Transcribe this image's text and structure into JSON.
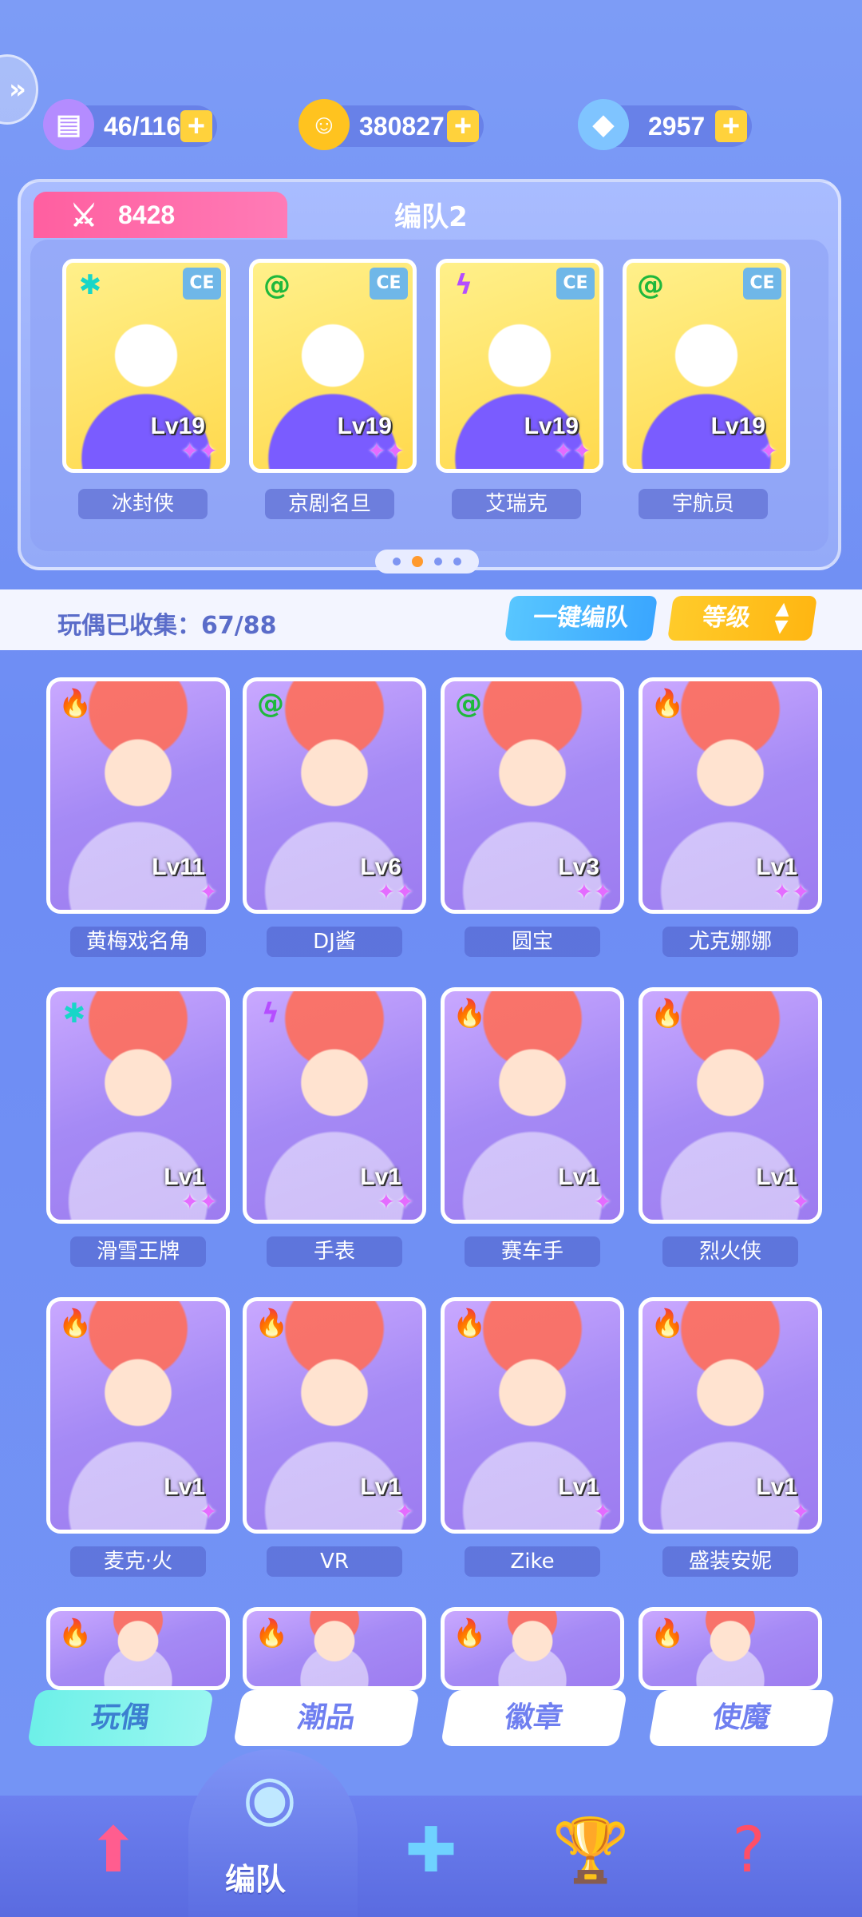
{
  "resources": [
    {
      "id": "stamina",
      "icon": "stamina-ticket-icon",
      "value": "46/116",
      "color": "#b48cff"
    },
    {
      "id": "coins",
      "icon": "coin-icon",
      "value": "380827",
      "color": "#ffc31f"
    },
    {
      "id": "gems",
      "icon": "crystal-icon",
      "value": "2957",
      "color": "#7fc4ff"
    }
  ],
  "team": {
    "power": "8428",
    "name": "编队2",
    "page_dots": 4,
    "active_page": 1,
    "members": [
      {
        "name": "冰封侠",
        "level": "Lv19",
        "element": "ice",
        "stars": "✦✦",
        "bg": "#fff08a"
      },
      {
        "name": "京剧名旦",
        "level": "Lv19",
        "element": "wind",
        "stars": "✦✦",
        "bg": "#fff08a"
      },
      {
        "name": "艾瑞克",
        "level": "Lv19",
        "element": "thunder",
        "stars": "✦✦",
        "bg": "#fff08a"
      },
      {
        "name": "宇航员",
        "level": "Lv19",
        "element": "wind",
        "stars": "✦",
        "bg": "#fff08a"
      }
    ],
    "badge": "CE"
  },
  "collection": {
    "label": "玩偶已收集：67/88",
    "onekey_label": "一键编队",
    "sort_label": "等级"
  },
  "dolls": [
    {
      "name": "黄梅戏名角",
      "level": "Lv11",
      "element": "fire",
      "stars": "✦"
    },
    {
      "name": "DJ酱",
      "level": "Lv6",
      "element": "wind",
      "stars": "✦✦"
    },
    {
      "name": "圆宝",
      "level": "Lv3",
      "element": "wind",
      "stars": "✦✦"
    },
    {
      "name": "尤克娜娜",
      "level": "Lv1",
      "element": "fire",
      "stars": "✦✦"
    },
    {
      "name": "滑雪王牌",
      "level": "Lv1",
      "element": "ice",
      "stars": "✦✦"
    },
    {
      "name": "手表",
      "level": "Lv1",
      "element": "thunder",
      "stars": "✦✦"
    },
    {
      "name": "赛车手",
      "level": "Lv1",
      "element": "fire",
      "stars": "✦"
    },
    {
      "name": "烈火侠",
      "level": "Lv1",
      "element": "fire",
      "stars": "✦"
    },
    {
      "name": "麦克·火",
      "level": "Lv1",
      "element": "fire",
      "stars": "✦"
    },
    {
      "name": "VR",
      "level": "Lv1",
      "element": "fire",
      "stars": "✦"
    },
    {
      "name": "Zike",
      "level": "Lv1",
      "element": "fire",
      "stars": "✦"
    },
    {
      "name": "盛装安妮",
      "level": "Lv1",
      "element": "fire",
      "stars": "✦"
    },
    {
      "name": "",
      "level": "",
      "element": "fire",
      "stars": ""
    },
    {
      "name": "",
      "level": "",
      "element": "fire",
      "stars": ""
    },
    {
      "name": "",
      "level": "",
      "element": "fire",
      "stars": ""
    },
    {
      "name": "",
      "level": "",
      "element": "fire",
      "stars": ""
    }
  ],
  "element_icons": {
    "fire": {
      "glyph": "🔥",
      "color": "#ff3b2f"
    },
    "wind": {
      "glyph": "@",
      "color": "#1fb83c"
    },
    "ice": {
      "glyph": "✱",
      "color": "#18d6c8"
    },
    "thunder": {
      "glyph": "ϟ",
      "color": "#b54dff"
    }
  },
  "category_tabs": [
    "玩偶",
    "潮品",
    "徽章",
    "使魔"
  ],
  "active_category": 0,
  "nav": {
    "active_label": "编队",
    "items": [
      "hero-icon",
      "whistle-icon",
      "puzzle-icon",
      "trophy-icon",
      "mystery-box-icon"
    ]
  }
}
